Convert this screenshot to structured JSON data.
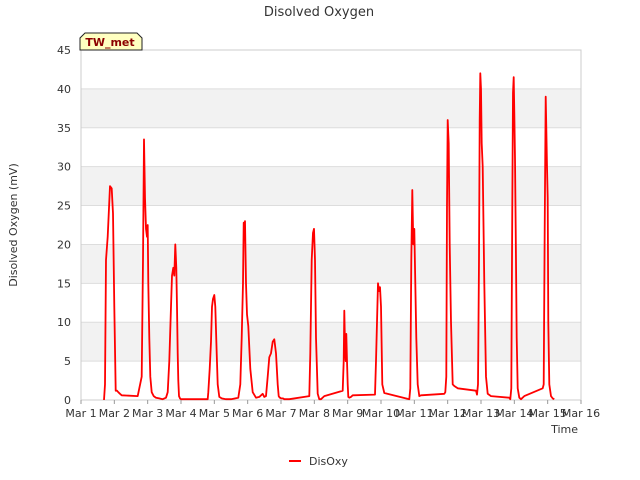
{
  "chart_data": {
    "type": "line",
    "title": "Disolved Oxygen",
    "xlabel": "Time",
    "ylabel": "Disolved Oxygen (mV)",
    "station_label": "TW_met",
    "xlim": [
      1,
      16
    ],
    "ylim": [
      0,
      45
    ],
    "x_ticks": [
      1,
      2,
      3,
      4,
      5,
      6,
      7,
      8,
      9,
      10,
      11,
      12,
      13,
      14,
      15,
      16
    ],
    "x_tick_labels": [
      "Mar 1",
      "Mar 2",
      "Mar 3",
      "Mar 4",
      "Mar 5",
      "Mar 6",
      "Mar 7",
      "Mar 8",
      "Mar 9",
      "Mar 10",
      "Mar 11",
      "Mar 12",
      "Mar 13",
      "Mar 14",
      "Mar 15",
      "Mar 16"
    ],
    "y_ticks": [
      0,
      5,
      10,
      15,
      20,
      25,
      30,
      35,
      40,
      45
    ],
    "y_tick_labels": [
      "0",
      "5",
      "10",
      "15",
      "20",
      "25",
      "30",
      "35",
      "40",
      "45"
    ],
    "grid": true,
    "legend_position": "bottom-center",
    "series": [
      {
        "name": "DisOxy",
        "color": "#ff0000",
        "x": [
          1.69,
          1.72,
          1.75,
          1.8,
          1.87,
          1.92,
          1.96,
          2.0,
          2.04,
          2.08,
          2.12,
          2.17,
          2.22,
          2.7,
          2.82,
          2.86,
          2.89,
          2.92,
          2.95,
          2.98,
          3.0,
          3.02,
          3.05,
          3.08,
          3.12,
          3.18,
          3.25,
          3.35,
          3.45,
          3.55,
          3.6,
          3.65,
          3.7,
          3.73,
          3.77,
          3.8,
          3.83,
          3.86,
          3.88,
          3.9,
          3.92,
          3.94,
          3.97,
          4.0,
          4.03,
          4.08,
          4.2,
          4.8,
          4.82,
          4.86,
          4.9,
          4.93,
          4.96,
          5.0,
          5.03,
          5.07,
          5.1,
          5.15,
          5.22,
          5.35,
          5.5,
          5.72,
          5.78,
          5.82,
          5.86,
          5.88,
          5.9,
          5.92,
          5.95,
          5.98,
          6.02,
          6.08,
          6.15,
          6.25,
          6.35,
          6.45,
          6.5,
          6.55,
          6.6,
          6.65,
          6.7,
          6.75,
          6.8,
          6.85,
          6.9,
          6.93,
          6.96,
          6.98,
          7.0,
          7.03,
          7.06,
          7.1,
          7.15,
          7.2,
          7.25,
          7.85,
          7.88,
          7.92,
          7.96,
          7.99,
          8.02,
          8.05,
          8.1,
          8.15,
          8.2,
          8.3,
          8.85,
          8.88,
          8.9,
          8.92,
          8.94,
          8.96,
          8.98,
          9.0,
          9.02,
          9.05,
          9.1,
          9.15,
          9.82,
          9.85,
          9.88,
          9.91,
          9.94,
          9.97,
          10.0,
          10.04,
          10.1,
          10.85,
          10.88,
          10.91,
          10.94,
          10.97,
          11.0,
          11.03,
          11.06,
          11.1,
          11.15,
          11.2,
          11.9,
          11.93,
          11.96,
          11.98,
          12.0,
          12.03,
          12.06,
          12.1,
          12.15,
          12.2,
          12.3,
          12.85,
          12.88,
          12.91,
          12.94,
          12.96,
          12.98,
          13.0,
          13.02,
          13.05,
          13.1,
          13.15,
          13.2,
          13.3,
          13.85,
          13.88,
          13.91,
          13.94,
          13.96,
          13.98,
          14.0,
          14.02,
          14.04,
          14.07,
          14.1,
          14.15,
          14.2,
          14.3,
          14.85,
          14.88,
          14.91,
          14.94,
          14.96,
          14.98,
          15.0,
          15.02,
          15.05,
          15.1,
          15.15,
          15.2
        ],
        "y": [
          0,
          2,
          18,
          21,
          27.5,
          27.2,
          24,
          12,
          1.2,
          1.2,
          1,
          0.8,
          0.6,
          0.5,
          3,
          18,
          33.5,
          26,
          22,
          21,
          22.5,
          15,
          8,
          3,
          1,
          0.5,
          0.3,
          0.2,
          0.1,
          0.3,
          1,
          5,
          12,
          16,
          17,
          16,
          20,
          17,
          12,
          6,
          2.5,
          0.5,
          0.2,
          0.1,
          0.1,
          0.1,
          0.1,
          0.1,
          1,
          4,
          7.5,
          12,
          13,
          13.5,
          12,
          6,
          2,
          0.4,
          0.2,
          0.1,
          0.1,
          0.3,
          2,
          8,
          15,
          22.8,
          21,
          23,
          15,
          11,
          9.5,
          4,
          1,
          0.3,
          0.4,
          0.8,
          0.4,
          0.5,
          3,
          5.5,
          6,
          7.5,
          7.8,
          6,
          2,
          0.5,
          0.3,
          0.3,
          0.2,
          0.2,
          0.2,
          0.1,
          0.1,
          0.1,
          0.1,
          0.5,
          6,
          18,
          21.5,
          22,
          18,
          8,
          0.8,
          0.1,
          0.1,
          0.5,
          1.2,
          5,
          11.5,
          7,
          5,
          8.5,
          5,
          2,
          0.4,
          0.3,
          0.4,
          0.6,
          0.7,
          5,
          10,
          15,
          14,
          14.5,
          12,
          2,
          0.9,
          0.1,
          1.5,
          18,
          27,
          20,
          22,
          15,
          8,
          2,
          0.5,
          0.6,
          0.8,
          1,
          3,
          25,
          36,
          33,
          20,
          10,
          2,
          1.8,
          1.5,
          1.2,
          0.7,
          2,
          18,
          36,
          42,
          40,
          33,
          30,
          15,
          3,
          0.8,
          0.5,
          0.3,
          0.1,
          1.5,
          25,
          39.5,
          41.5,
          37,
          31,
          22,
          8,
          1.5,
          0.3,
          0.1,
          0.5,
          1.5,
          2,
          22,
          39,
          35,
          30,
          26,
          10,
          2,
          0.5,
          0.2,
          0.1
        ]
      }
    ]
  }
}
